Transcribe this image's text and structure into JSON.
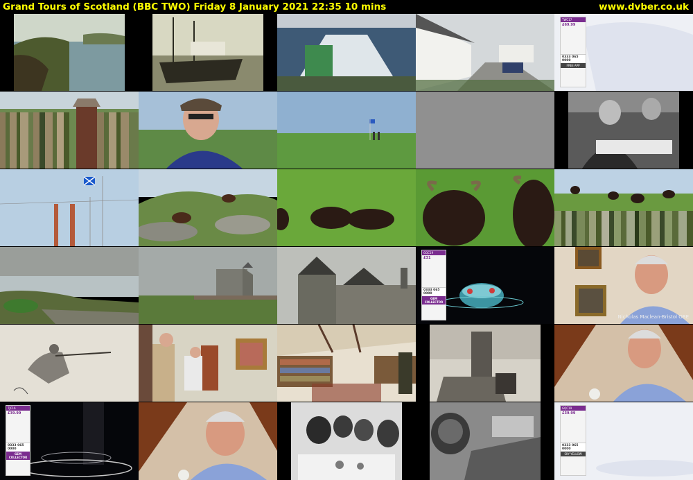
{
  "header": {
    "title": "Grand Tours of Scotland (BBC TWO)    Friday 8 January 2021  22:35  10 mins",
    "site": "www.dvber.co.uk"
  },
  "colors": {
    "header_text": "#ffff00",
    "background": "#000000",
    "shopping_accent": "#7a2c8f"
  },
  "tiles": [
    {
      "name": "coastal-loch-frame"
    },
    {
      "name": "harbour-boats-frame"
    },
    {
      "name": "ferry-wake-frame"
    },
    {
      "name": "village-street-frame"
    },
    {
      "name": "shopping-channel-frame-1"
    },
    {
      "name": "presenter-hat-glitch-frame"
    },
    {
      "name": "presenter-closeup-frame"
    },
    {
      "name": "flag-field-frame"
    },
    {
      "name": "blank-grey-frame"
    },
    {
      "name": "archive-bw-men-frame"
    },
    {
      "name": "saltire-chimneys-frame"
    },
    {
      "name": "sheep-rocks-frame"
    },
    {
      "name": "sheep-grass-frame"
    },
    {
      "name": "horned-sheep-frame"
    },
    {
      "name": "sheep-hill-glitch-frame"
    },
    {
      "name": "beach-grass-frame"
    },
    {
      "name": "castle-distant-frame"
    },
    {
      "name": "castle-tower-frame"
    },
    {
      "name": "shopping-channel-frame-2"
    },
    {
      "name": "interview-paintings-frame"
    },
    {
      "name": "sketch-rifleman-frame"
    },
    {
      "name": "two-men-room-frame"
    },
    {
      "name": "library-room-frame"
    },
    {
      "name": "tower-painting-frame"
    },
    {
      "name": "interview-attic-frame-1"
    },
    {
      "name": "shopping-channel-frame-3"
    },
    {
      "name": "interview-attic-frame-2"
    },
    {
      "name": "archive-bw-table-frame"
    },
    {
      "name": "archive-bw-tower-aerial-frame"
    },
    {
      "name": "shopping-channel-frame-4"
    }
  ],
  "captions": {
    "interview_name": "Nicholas Maclean-Bristol OBE"
  },
  "shopping_cards": {
    "card1": {
      "tag": "TWC17",
      "price": "£69.99",
      "phone": "0333 065 0000",
      "app": "FREE APP"
    },
    "card2": {
      "tag": "GQC19",
      "price": "£31",
      "phone": "0333 065 0000",
      "brand": "GEM COLLECTOR"
    },
    "card3": {
      "tag": "TJC16",
      "price": "£39.99",
      "phone": "0333 065 0000",
      "brand": "GEM COLLECTOR"
    },
    "card4": {
      "tag": "GQC19",
      "price": "£39.99",
      "phone": "0333 065 0000",
      "brand": "SKY YELLOW"
    }
  }
}
